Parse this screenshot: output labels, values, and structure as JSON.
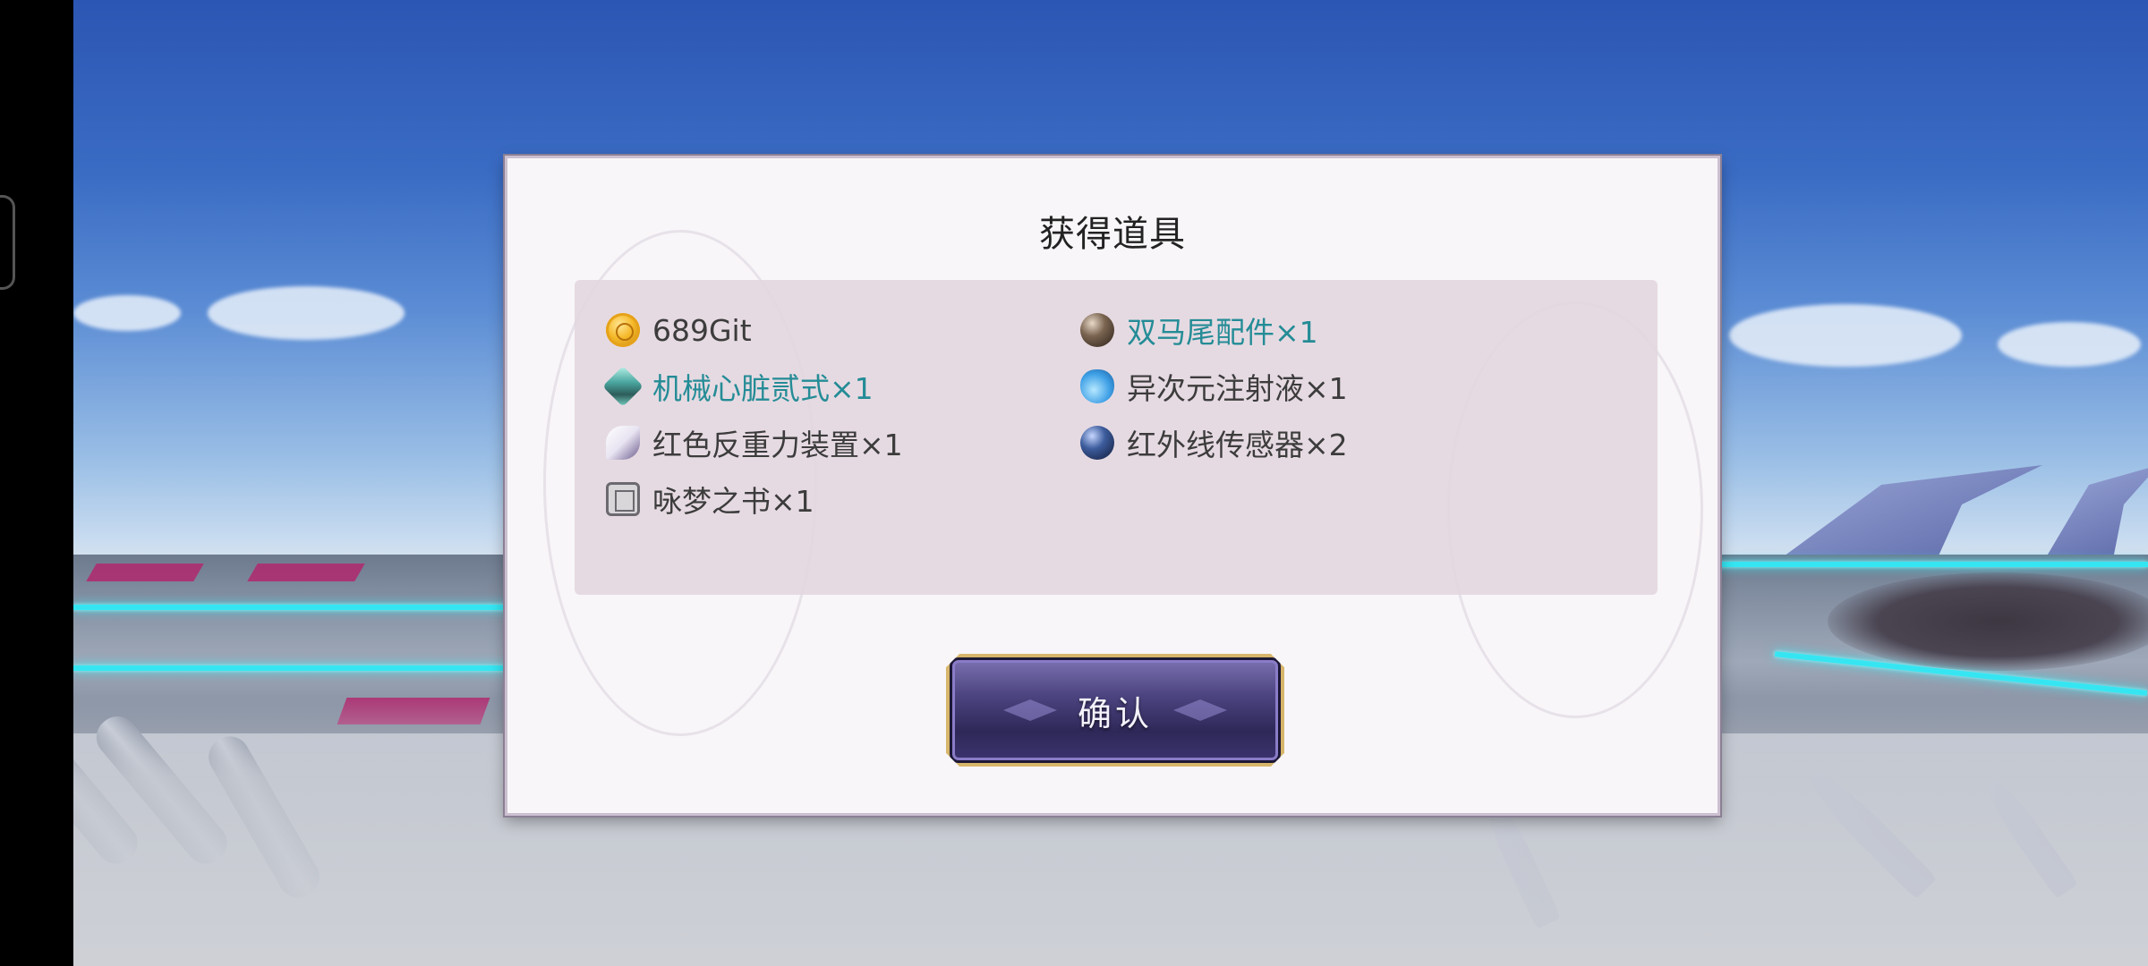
{
  "dialog": {
    "title": "获得道具",
    "confirm_label": "确认"
  },
  "rewards": [
    {
      "name": "689Git",
      "icon": "gold-coin-icon",
      "rare": false
    },
    {
      "name": "双马尾配件×1",
      "icon": "brown-orb-icon",
      "rare": true
    },
    {
      "name": "机械心脏贰式×1",
      "icon": "crystal-icon",
      "rare": true
    },
    {
      "name": "异次元注射液×1",
      "icon": "potion-icon",
      "rare": false
    },
    {
      "name": "红色反重力装置×1",
      "icon": "feather-icon",
      "rare": false
    },
    {
      "name": "红外线传感器×2",
      "icon": "blue-orb-icon",
      "rare": false
    },
    {
      "name": "咏梦之书×1",
      "icon": "book-icon",
      "rare": false
    }
  ],
  "colors": {
    "rare_text": "#248c96",
    "normal_text": "#3c3c3c",
    "button_border": "#d7b56a",
    "neon": "#35e6f2"
  }
}
